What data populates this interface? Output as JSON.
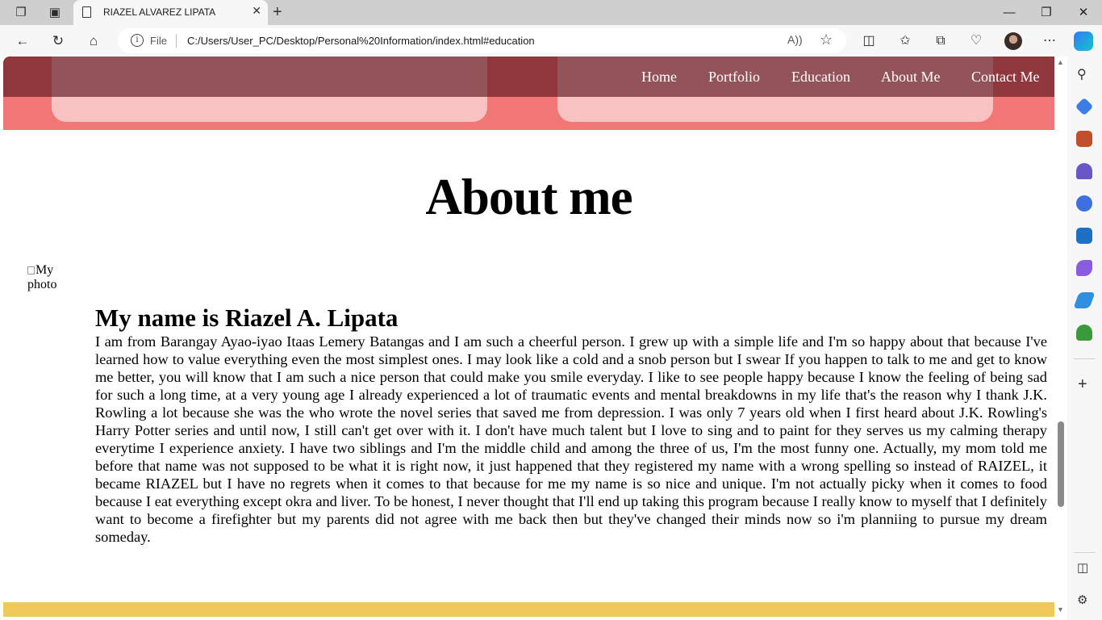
{
  "browser": {
    "tab": {
      "title": "RIAZEL ALVAREZ LIPATA"
    },
    "address": {
      "scheme_label": "File",
      "url": "C:/Users/User_PC/Desktop/Personal%20Information/index.html#education"
    }
  },
  "site": {
    "nav": {
      "items": [
        {
          "label": "Home"
        },
        {
          "label": "Portfolio"
        },
        {
          "label": "Education"
        },
        {
          "label": "About Me"
        },
        {
          "label": "Contact Me"
        }
      ]
    },
    "about": {
      "title": "About me",
      "photo_alt": "My photo",
      "heading": "My name is Riazel A. Lipata",
      "bio": "I am from Barangay Ayao-iyao Itaas Lemery Batangas and I am such a cheerful person. I grew up with a simple life and I'm so happy about that because I've learned how to value everything even the most simplest ones. I may look like a cold and a snob person but I swear If you happen to talk to me and get to know me better, you will know that I am such a nice person that could make you smile everyday. I like to see people happy because I know the feeling of being sad for such a long time, at a very young age I already experienced a lot of traumatic events and mental breakdowns in my life that's the reason why I thank J.K. Rowling a lot because she was the who wrote the novel series that saved me from depression. I was only 7 years old when I first heard about J.K. Rowling's Harry Potter series and until now, I still can't get over with it. I don't have much talent but I love to sing and to paint for they serves us my calming therapy everytime I experience anxiety. I have two siblings and I'm the middle child and among the three of us, I'm the most funny one. Actually, my mom told me before that name was not supposed to be what it is right now, it just happened that they registered my name with a wrong spelling so instead of RAIZEL, it became RIAZEL but I have no regrets when it comes to that because for me my name is so nice and unique. I'm not actually picky when it comes to food because I eat everything except okra and liver. To be honest, I never thought that I'll end up taking this program because I really know to myself that I definitely want to become a firefighter but my parents did not agree with me back then but they've changed their minds now so i'm planniing to pursue my dream someday."
    }
  },
  "colors": {
    "hero": "#f17676",
    "card": "#f8c2c2",
    "navbar": "#7d2c3a",
    "footer": "#efc95a"
  }
}
